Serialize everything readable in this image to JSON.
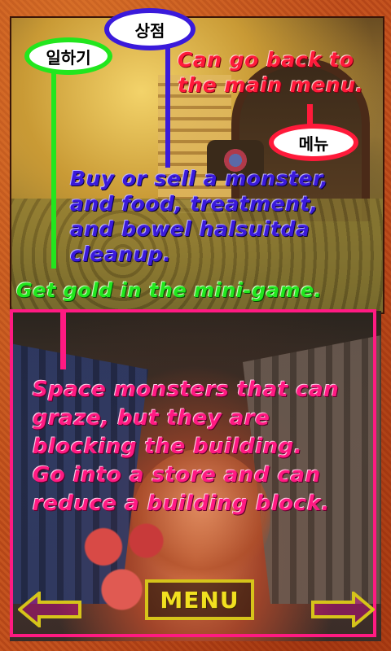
{
  "labels": {
    "shop": "상점",
    "work": "일하기",
    "menu": "메뉴"
  },
  "notes": {
    "menu_desc": "Can go back to\nthe main menu.",
    "shop_desc": "Buy or sell a monster,\nand food, treatment,\nand bowel halsuitda\ncleanup.",
    "work_desc": "Get gold in the mini-game.",
    "space_desc": "Space monsters that can\ngraze, but they are\nblocking the building.\nGo into a store and can\nreduce a building block."
  },
  "controls": {
    "menu_button": "MENU",
    "left_arrow_icon": "arrow-left-icon",
    "right_arrow_icon": "arrow-right-icon"
  },
  "colors": {
    "shop": "#3a1adb",
    "work": "#22e61e",
    "menu": "#ff1a3a",
    "space": "#ff1a82",
    "button": "#d6c41a"
  }
}
